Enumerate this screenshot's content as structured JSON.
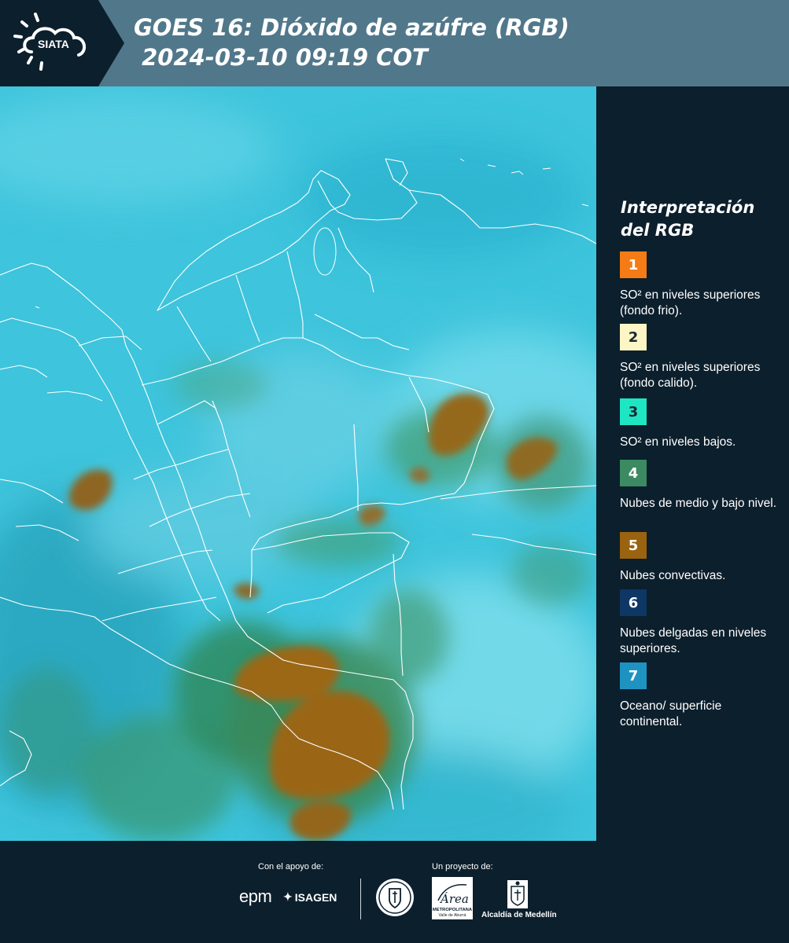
{
  "header": {
    "logo_text": "SIATA",
    "title_line1": "GOES 16: Dióxido de azúfre (RGB)",
    "title_line2": " 2024-03-10 09:19 COT"
  },
  "legend": {
    "title_line1": "Interpretación",
    "title_line2": "del RGB",
    "items": [
      {
        "number": "1",
        "color": "#f57c14",
        "text_color": "#ffffff",
        "label": "SO² en niveles superiores (fondo frio)."
      },
      {
        "number": "2",
        "color": "#fdf6c4",
        "text_color": "#1a2a35",
        "label": "SO² en niveles superiores (fondo calido)."
      },
      {
        "number": "3",
        "color": "#1fe6c2",
        "text_color": "#1a2a35",
        "label": "SO² en niveles bajos."
      },
      {
        "number": "4",
        "color": "#3b8a61",
        "text_color": "#ffffff",
        "label": "Nubes de medio y bajo nivel."
      },
      {
        "number": "5",
        "color": "#9a6310",
        "text_color": "#ffffff",
        "label": "Nubes convectivas."
      },
      {
        "number": "6",
        "color": "#0f3765",
        "text_color": "#ffffff",
        "label": "Nubes delgadas en niveles superiores."
      },
      {
        "number": "7",
        "color": "#1e93c2",
        "text_color": "#ffffff",
        "label": "Oceano/ superficie continental."
      }
    ]
  },
  "footer": {
    "support_label": "Con el apoyo de:",
    "project_label": "Un proyecto de:",
    "sponsor_epm": "epm",
    "sponsor_isagen": "ISAGEN",
    "partner_area_logo": "Área",
    "partner_area_line1": "METROPOLITANA",
    "partner_area_line2": "Valle de Aburrá",
    "partner_alcaldia": "Alcaldía de Medellín"
  },
  "colors": {
    "header_bg": "#51778a",
    "panel_bg": "#0c1f2c",
    "map_base": "#3cc8de"
  }
}
